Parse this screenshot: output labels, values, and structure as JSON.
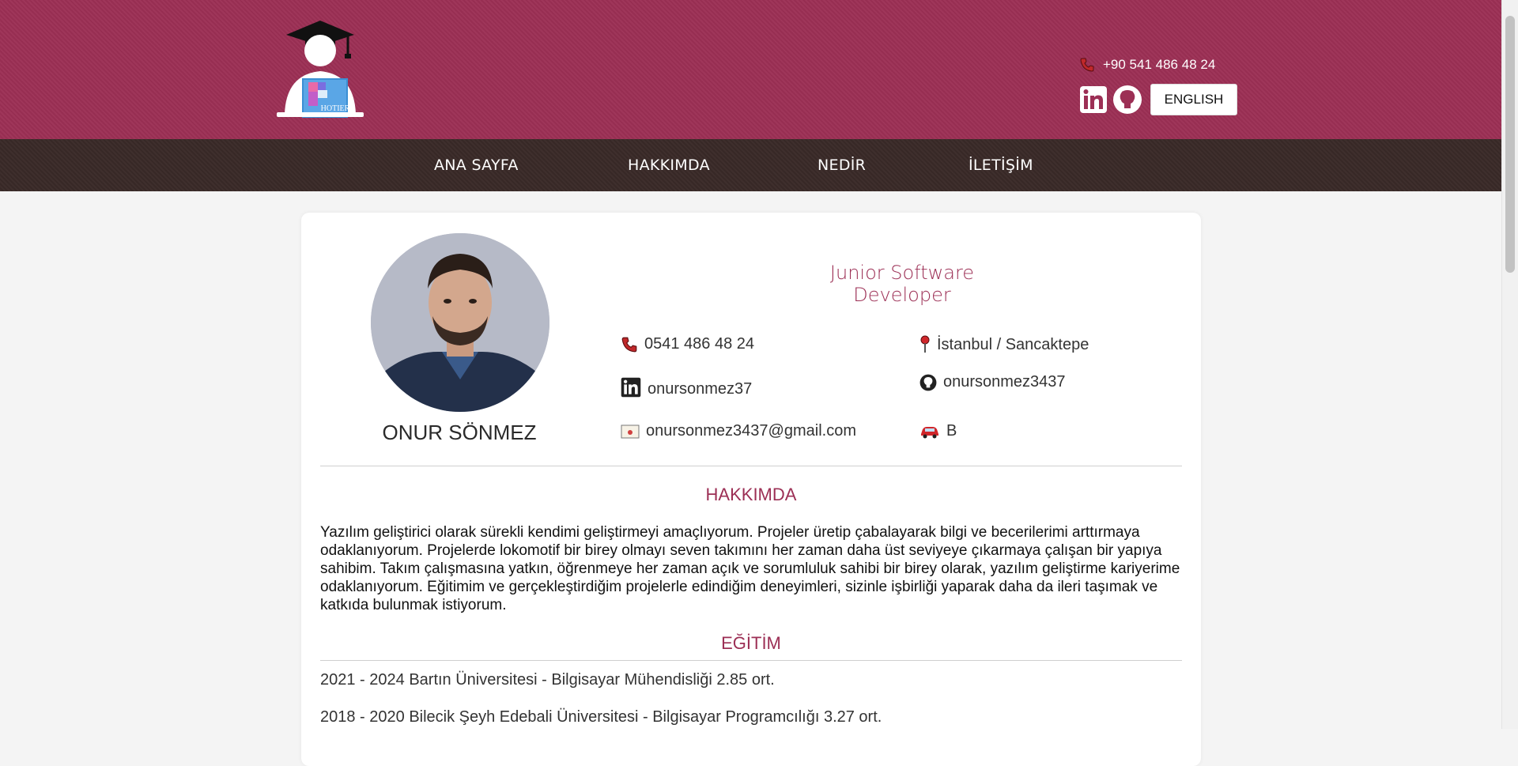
{
  "header": {
    "phone": "+90 541 486 48 24",
    "language_button": "ENGLISH",
    "logo_text": "HOTIER"
  },
  "nav": {
    "items": [
      "ANA SAYFA",
      "HAKKIMDA",
      "NEDİR",
      "İLETİŞİM"
    ]
  },
  "profile": {
    "name": "ONUR SÖNMEZ",
    "role": "Junior Software Developer",
    "phone": "0541 486 48 24",
    "location": "İstanbul / Sancaktepe",
    "linkedin": "onursonmez37",
    "github": "onursonmez3437",
    "email": "onursonmez3437@gmail.com",
    "license": "B"
  },
  "about": {
    "title": "HAKKIMDA",
    "text": "Yazılım geliştirici olarak sürekli kendimi geliştirmeyi amaçlıyorum. Projeler üretip çabalayarak bilgi ve becerilerimi arttırmaya odaklanıyorum. Projelerde lokomotif bir birey olmayı seven takımını her zaman daha üst seviyeye çıkarmaya çalışan bir yapıya sahibim. Takım çalışmasına yatkın, öğrenmeye her zaman açık ve sorumluluk sahibi bir birey olarak, yazılım geliştirme kariyerime odaklanıyorum. Eğitimim ve gerçekleştirdiğim projelerle edindiğim deneyimleri, sizinle işbirliği yaparak daha da ileri taşımak ve katkıda bulunmak istiyorum."
  },
  "education": {
    "title": "EĞİTİM",
    "items": [
      "2021 - 2024 Bartın Üniversitesi - Bilgisayar Mühendisliği 2.85 ort.",
      "2018 - 2020 Bilecik Şeyh Edebali Üniversitesi - Bilgisayar Programcılığı 3.27 ort."
    ]
  },
  "colors": {
    "brand": "#9c2f55",
    "nav_bg": "#3a2a28"
  }
}
